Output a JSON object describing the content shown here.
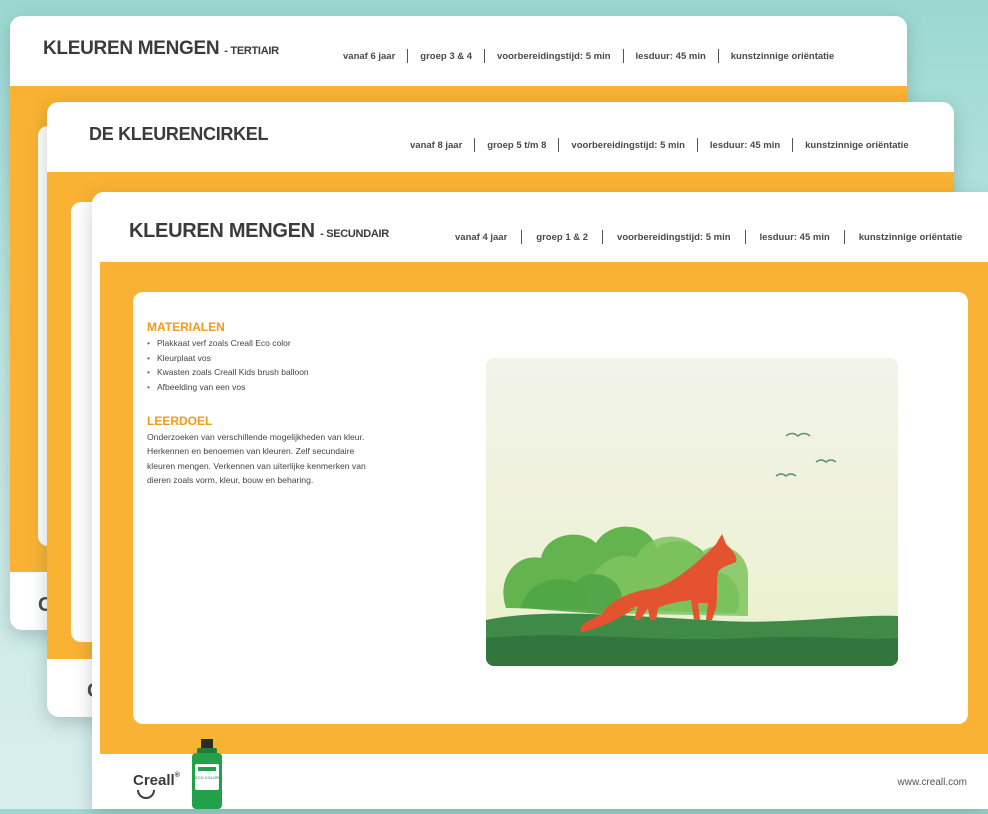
{
  "cards": {
    "tertiair": {
      "title": "KLEUREN MENGEN",
      "subtitle": "- TERTIAIR",
      "meta": [
        "vanaf 6 jaar",
        "groep 3 & 4",
        "voorbereidingstijd: 5 min",
        "lesduur: 45 min",
        "kunstzinnige oriëntatie"
      ],
      "footer_logo": "Cr"
    },
    "kleurencirkel": {
      "title": "DE KLEURENCIRKEL",
      "meta": [
        "vanaf 8 jaar",
        "groep 5 t/m 8",
        "voorbereidingstijd: 5 min",
        "lesduur: 45 min",
        "kunstzinnige oriëntatie"
      ],
      "footer_logo": "Cr"
    },
    "secundair": {
      "title": "KLEUREN MENGEN",
      "subtitle": "- SECUNDAIR",
      "meta": [
        "vanaf 4 jaar",
        "groep 1 & 2",
        "voorbereidingstijd: 5 min",
        "lesduur: 45 min",
        "kunstzinnige oriëntatie"
      ],
      "materials_heading": "MATERIALEN",
      "materials": [
        "Plakkaat verf zoals Creall Eco color",
        "Kleurplaat vos",
        "Kwasten zoals Creall Kids brush balloon",
        "Afbeelding van een vos"
      ],
      "goal_heading": "LEERDOEL",
      "goal_lines": [
        "Onderzoeken van verschillende mogelijkheden van kleur.",
        "Herkennen en benoemen van kleuren. Zelf secundaire",
        "kleuren mengen. Verkennen van uiterlijke kenmerken van",
        "dieren zoals vorm, kleur, bouw en beharing."
      ]
    }
  },
  "footer": {
    "logo": "Creall",
    "logo_reg": "®",
    "website": "www.creall.com",
    "bottle_label": "ECO COLOR"
  },
  "colors": {
    "accent": "#f9b233",
    "heading": "#f29a1c",
    "background": "#bfe6e2"
  }
}
